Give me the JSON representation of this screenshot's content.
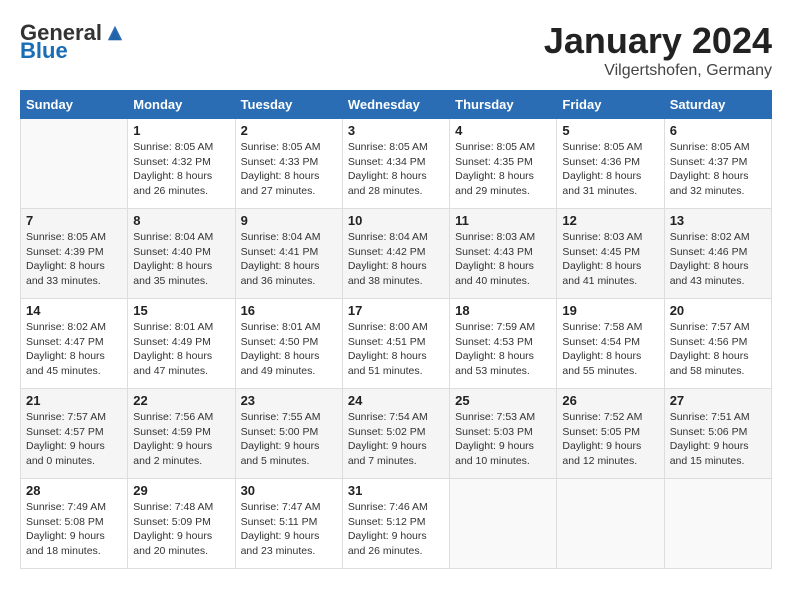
{
  "logo": {
    "general": "General",
    "blue": "Blue"
  },
  "title": "January 2024",
  "location": "Vilgertshofen, Germany",
  "days_header": [
    "Sunday",
    "Monday",
    "Tuesday",
    "Wednesday",
    "Thursday",
    "Friday",
    "Saturday"
  ],
  "weeks": [
    [
      {
        "num": "",
        "info": ""
      },
      {
        "num": "1",
        "info": "Sunrise: 8:05 AM\nSunset: 4:32 PM\nDaylight: 8 hours\nand 26 minutes."
      },
      {
        "num": "2",
        "info": "Sunrise: 8:05 AM\nSunset: 4:33 PM\nDaylight: 8 hours\nand 27 minutes."
      },
      {
        "num": "3",
        "info": "Sunrise: 8:05 AM\nSunset: 4:34 PM\nDaylight: 8 hours\nand 28 minutes."
      },
      {
        "num": "4",
        "info": "Sunrise: 8:05 AM\nSunset: 4:35 PM\nDaylight: 8 hours\nand 29 minutes."
      },
      {
        "num": "5",
        "info": "Sunrise: 8:05 AM\nSunset: 4:36 PM\nDaylight: 8 hours\nand 31 minutes."
      },
      {
        "num": "6",
        "info": "Sunrise: 8:05 AM\nSunset: 4:37 PM\nDaylight: 8 hours\nand 32 minutes."
      }
    ],
    [
      {
        "num": "7",
        "info": "Sunrise: 8:05 AM\nSunset: 4:39 PM\nDaylight: 8 hours\nand 33 minutes."
      },
      {
        "num": "8",
        "info": "Sunrise: 8:04 AM\nSunset: 4:40 PM\nDaylight: 8 hours\nand 35 minutes."
      },
      {
        "num": "9",
        "info": "Sunrise: 8:04 AM\nSunset: 4:41 PM\nDaylight: 8 hours\nand 36 minutes."
      },
      {
        "num": "10",
        "info": "Sunrise: 8:04 AM\nSunset: 4:42 PM\nDaylight: 8 hours\nand 38 minutes."
      },
      {
        "num": "11",
        "info": "Sunrise: 8:03 AM\nSunset: 4:43 PM\nDaylight: 8 hours\nand 40 minutes."
      },
      {
        "num": "12",
        "info": "Sunrise: 8:03 AM\nSunset: 4:45 PM\nDaylight: 8 hours\nand 41 minutes."
      },
      {
        "num": "13",
        "info": "Sunrise: 8:02 AM\nSunset: 4:46 PM\nDaylight: 8 hours\nand 43 minutes."
      }
    ],
    [
      {
        "num": "14",
        "info": "Sunrise: 8:02 AM\nSunset: 4:47 PM\nDaylight: 8 hours\nand 45 minutes."
      },
      {
        "num": "15",
        "info": "Sunrise: 8:01 AM\nSunset: 4:49 PM\nDaylight: 8 hours\nand 47 minutes."
      },
      {
        "num": "16",
        "info": "Sunrise: 8:01 AM\nSunset: 4:50 PM\nDaylight: 8 hours\nand 49 minutes."
      },
      {
        "num": "17",
        "info": "Sunrise: 8:00 AM\nSunset: 4:51 PM\nDaylight: 8 hours\nand 51 minutes."
      },
      {
        "num": "18",
        "info": "Sunrise: 7:59 AM\nSunset: 4:53 PM\nDaylight: 8 hours\nand 53 minutes."
      },
      {
        "num": "19",
        "info": "Sunrise: 7:58 AM\nSunset: 4:54 PM\nDaylight: 8 hours\nand 55 minutes."
      },
      {
        "num": "20",
        "info": "Sunrise: 7:57 AM\nSunset: 4:56 PM\nDaylight: 8 hours\nand 58 minutes."
      }
    ],
    [
      {
        "num": "21",
        "info": "Sunrise: 7:57 AM\nSunset: 4:57 PM\nDaylight: 9 hours\nand 0 minutes."
      },
      {
        "num": "22",
        "info": "Sunrise: 7:56 AM\nSunset: 4:59 PM\nDaylight: 9 hours\nand 2 minutes."
      },
      {
        "num": "23",
        "info": "Sunrise: 7:55 AM\nSunset: 5:00 PM\nDaylight: 9 hours\nand 5 minutes."
      },
      {
        "num": "24",
        "info": "Sunrise: 7:54 AM\nSunset: 5:02 PM\nDaylight: 9 hours\nand 7 minutes."
      },
      {
        "num": "25",
        "info": "Sunrise: 7:53 AM\nSunset: 5:03 PM\nDaylight: 9 hours\nand 10 minutes."
      },
      {
        "num": "26",
        "info": "Sunrise: 7:52 AM\nSunset: 5:05 PM\nDaylight: 9 hours\nand 12 minutes."
      },
      {
        "num": "27",
        "info": "Sunrise: 7:51 AM\nSunset: 5:06 PM\nDaylight: 9 hours\nand 15 minutes."
      }
    ],
    [
      {
        "num": "28",
        "info": "Sunrise: 7:49 AM\nSunset: 5:08 PM\nDaylight: 9 hours\nand 18 minutes."
      },
      {
        "num": "29",
        "info": "Sunrise: 7:48 AM\nSunset: 5:09 PM\nDaylight: 9 hours\nand 20 minutes."
      },
      {
        "num": "30",
        "info": "Sunrise: 7:47 AM\nSunset: 5:11 PM\nDaylight: 9 hours\nand 23 minutes."
      },
      {
        "num": "31",
        "info": "Sunrise: 7:46 AM\nSunset: 5:12 PM\nDaylight: 9 hours\nand 26 minutes."
      },
      {
        "num": "",
        "info": ""
      },
      {
        "num": "",
        "info": ""
      },
      {
        "num": "",
        "info": ""
      }
    ]
  ]
}
